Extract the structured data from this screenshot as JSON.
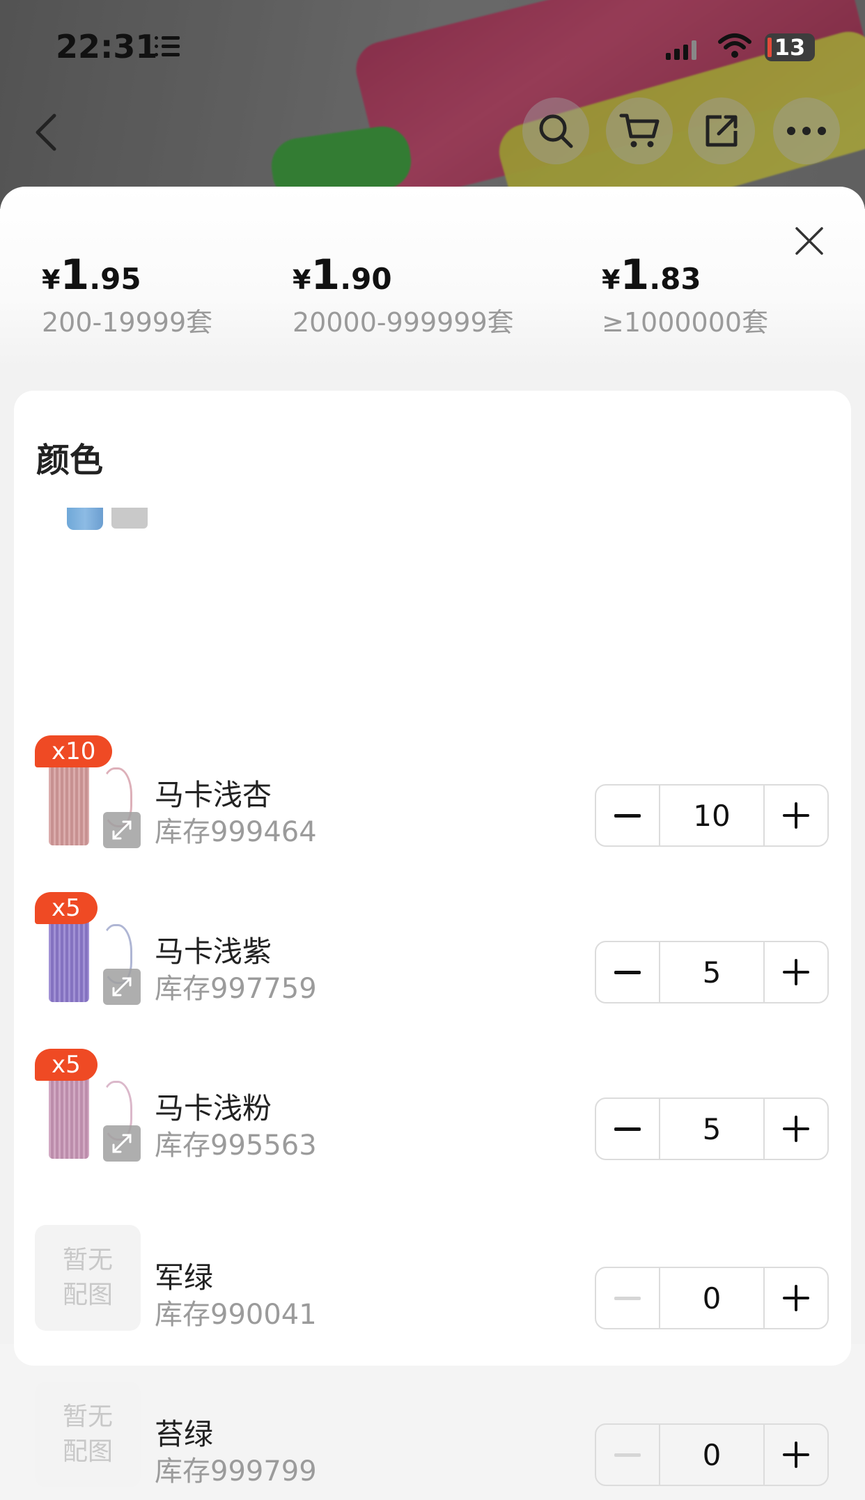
{
  "status_bar": {
    "time": "22:31",
    "battery": "13"
  },
  "price_tiers": [
    {
      "yen": "¥",
      "int": "1",
      "dec": ".95",
      "range": "200-19999套"
    },
    {
      "yen": "¥",
      "int": "1",
      "dec": ".90",
      "range": "20000-999999套"
    },
    {
      "yen": "¥",
      "int": "1",
      "dec": ".83",
      "range": "≥1000000套"
    }
  ],
  "section": {
    "title": "颜色"
  },
  "variants": [
    {
      "badge": "x10",
      "name": "马卡浅杏",
      "stock": "库存999464",
      "quantity": "10",
      "color": "#d39a9a"
    },
    {
      "badge": "x5",
      "name": "马卡浅紫",
      "stock": "库存997759",
      "quantity": "5",
      "color": "#8c79cc"
    },
    {
      "badge": "x5",
      "name": "马卡浅粉",
      "stock": "库存995563",
      "quantity": "5",
      "color": "#c896b6"
    },
    {
      "placeholder": "暂无\n配图",
      "placeholder_line1": "暂无",
      "placeholder_line2": "配图",
      "name": "军绿",
      "stock": "库存990041",
      "quantity": "0"
    },
    {
      "placeholder_line1": "暂无",
      "placeholder_line2": "配图",
      "name": "苔绿",
      "stock": "库存999799",
      "quantity": "0"
    }
  ],
  "icons": {
    "back": "chevron-left-icon",
    "search": "search-icon",
    "cart": "cart-icon",
    "share": "share-icon",
    "more": "more-icon",
    "close": "close-icon",
    "expand": "expand-icon",
    "minus": "minus-icon",
    "plus": "plus-icon"
  },
  "colors": {
    "badge": "#ef4a24",
    "disabled": "#d6d6d6"
  }
}
